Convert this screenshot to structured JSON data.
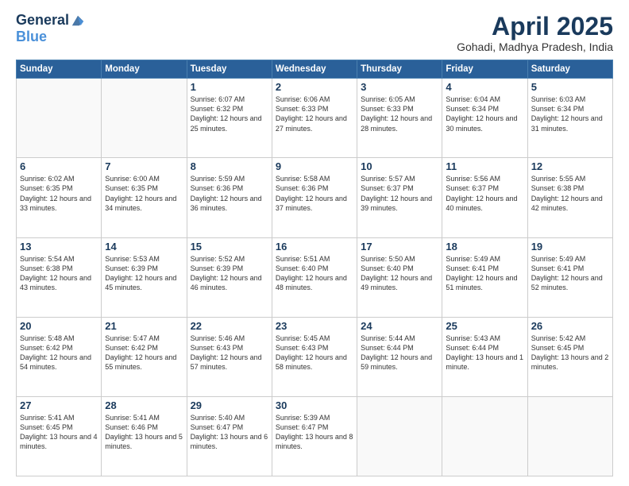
{
  "header": {
    "logo_line1": "General",
    "logo_line2": "Blue",
    "month_year": "April 2025",
    "location": "Gohadi, Madhya Pradesh, India"
  },
  "days_of_week": [
    "Sunday",
    "Monday",
    "Tuesday",
    "Wednesday",
    "Thursday",
    "Friday",
    "Saturday"
  ],
  "weeks": [
    [
      {
        "day": "",
        "info": ""
      },
      {
        "day": "",
        "info": ""
      },
      {
        "day": "1",
        "info": "Sunrise: 6:07 AM\nSunset: 6:32 PM\nDaylight: 12 hours\nand 25 minutes."
      },
      {
        "day": "2",
        "info": "Sunrise: 6:06 AM\nSunset: 6:33 PM\nDaylight: 12 hours\nand 27 minutes."
      },
      {
        "day": "3",
        "info": "Sunrise: 6:05 AM\nSunset: 6:33 PM\nDaylight: 12 hours\nand 28 minutes."
      },
      {
        "day": "4",
        "info": "Sunrise: 6:04 AM\nSunset: 6:34 PM\nDaylight: 12 hours\nand 30 minutes."
      },
      {
        "day": "5",
        "info": "Sunrise: 6:03 AM\nSunset: 6:34 PM\nDaylight: 12 hours\nand 31 minutes."
      }
    ],
    [
      {
        "day": "6",
        "info": "Sunrise: 6:02 AM\nSunset: 6:35 PM\nDaylight: 12 hours\nand 33 minutes."
      },
      {
        "day": "7",
        "info": "Sunrise: 6:00 AM\nSunset: 6:35 PM\nDaylight: 12 hours\nand 34 minutes."
      },
      {
        "day": "8",
        "info": "Sunrise: 5:59 AM\nSunset: 6:36 PM\nDaylight: 12 hours\nand 36 minutes."
      },
      {
        "day": "9",
        "info": "Sunrise: 5:58 AM\nSunset: 6:36 PM\nDaylight: 12 hours\nand 37 minutes."
      },
      {
        "day": "10",
        "info": "Sunrise: 5:57 AM\nSunset: 6:37 PM\nDaylight: 12 hours\nand 39 minutes."
      },
      {
        "day": "11",
        "info": "Sunrise: 5:56 AM\nSunset: 6:37 PM\nDaylight: 12 hours\nand 40 minutes."
      },
      {
        "day": "12",
        "info": "Sunrise: 5:55 AM\nSunset: 6:38 PM\nDaylight: 12 hours\nand 42 minutes."
      }
    ],
    [
      {
        "day": "13",
        "info": "Sunrise: 5:54 AM\nSunset: 6:38 PM\nDaylight: 12 hours\nand 43 minutes."
      },
      {
        "day": "14",
        "info": "Sunrise: 5:53 AM\nSunset: 6:39 PM\nDaylight: 12 hours\nand 45 minutes."
      },
      {
        "day": "15",
        "info": "Sunrise: 5:52 AM\nSunset: 6:39 PM\nDaylight: 12 hours\nand 46 minutes."
      },
      {
        "day": "16",
        "info": "Sunrise: 5:51 AM\nSunset: 6:40 PM\nDaylight: 12 hours\nand 48 minutes."
      },
      {
        "day": "17",
        "info": "Sunrise: 5:50 AM\nSunset: 6:40 PM\nDaylight: 12 hours\nand 49 minutes."
      },
      {
        "day": "18",
        "info": "Sunrise: 5:49 AM\nSunset: 6:41 PM\nDaylight: 12 hours\nand 51 minutes."
      },
      {
        "day": "19",
        "info": "Sunrise: 5:49 AM\nSunset: 6:41 PM\nDaylight: 12 hours\nand 52 minutes."
      }
    ],
    [
      {
        "day": "20",
        "info": "Sunrise: 5:48 AM\nSunset: 6:42 PM\nDaylight: 12 hours\nand 54 minutes."
      },
      {
        "day": "21",
        "info": "Sunrise: 5:47 AM\nSunset: 6:42 PM\nDaylight: 12 hours\nand 55 minutes."
      },
      {
        "day": "22",
        "info": "Sunrise: 5:46 AM\nSunset: 6:43 PM\nDaylight: 12 hours\nand 57 minutes."
      },
      {
        "day": "23",
        "info": "Sunrise: 5:45 AM\nSunset: 6:43 PM\nDaylight: 12 hours\nand 58 minutes."
      },
      {
        "day": "24",
        "info": "Sunrise: 5:44 AM\nSunset: 6:44 PM\nDaylight: 12 hours\nand 59 minutes."
      },
      {
        "day": "25",
        "info": "Sunrise: 5:43 AM\nSunset: 6:44 PM\nDaylight: 13 hours\nand 1 minute."
      },
      {
        "day": "26",
        "info": "Sunrise: 5:42 AM\nSunset: 6:45 PM\nDaylight: 13 hours\nand 2 minutes."
      }
    ],
    [
      {
        "day": "27",
        "info": "Sunrise: 5:41 AM\nSunset: 6:45 PM\nDaylight: 13 hours\nand 4 minutes."
      },
      {
        "day": "28",
        "info": "Sunrise: 5:41 AM\nSunset: 6:46 PM\nDaylight: 13 hours\nand 5 minutes."
      },
      {
        "day": "29",
        "info": "Sunrise: 5:40 AM\nSunset: 6:47 PM\nDaylight: 13 hours\nand 6 minutes."
      },
      {
        "day": "30",
        "info": "Sunrise: 5:39 AM\nSunset: 6:47 PM\nDaylight: 13 hours\nand 8 minutes."
      },
      {
        "day": "",
        "info": ""
      },
      {
        "day": "",
        "info": ""
      },
      {
        "day": "",
        "info": ""
      }
    ]
  ]
}
